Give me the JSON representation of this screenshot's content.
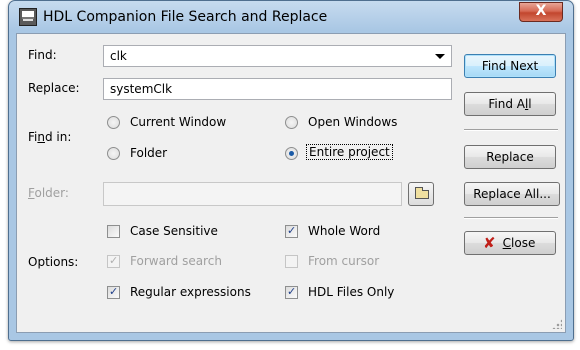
{
  "window": {
    "title": "HDL Companion File Search and Replace",
    "close_glyph": "X"
  },
  "find": {
    "label": "Find:",
    "value": "clk"
  },
  "replace": {
    "label": "Replace:",
    "value": "systemClk"
  },
  "find_in": {
    "label_pre": "Fi",
    "label_u": "n",
    "label_post": "d in:",
    "options": [
      {
        "label": "Current Window",
        "selected": false
      },
      {
        "label": "Open Windows",
        "selected": false
      },
      {
        "label": "Folder",
        "selected": false
      },
      {
        "label": "Entire project",
        "selected": true
      }
    ]
  },
  "folder": {
    "label_u": "F",
    "label_post": "older:",
    "value": ""
  },
  "options": {
    "label": "Options:",
    "case_sensitive": {
      "label": "Case Sensitive",
      "checked": false,
      "enabled": true
    },
    "whole_word": {
      "label": "Whole Word",
      "checked": true,
      "enabled": true
    },
    "forward_search": {
      "label": "Forward search",
      "checked": true,
      "enabled": false
    },
    "from_cursor": {
      "label": "From cursor",
      "checked": false,
      "enabled": false
    },
    "regular_expressions": {
      "label": "Regular expressions",
      "checked": true,
      "enabled": true
    },
    "hdl_files_only": {
      "label": "HDL Files Only",
      "checked": true,
      "enabled": true
    }
  },
  "buttons": {
    "find_next": "Find Next",
    "find_all_pre": "Find A",
    "find_all_u": "l",
    "find_all_post": "l",
    "replace": "Replace",
    "replace_all": "Replace All...",
    "close_u": "C",
    "close_post": "lose"
  },
  "icons": {
    "close_icon": "✘",
    "check_mark": "✓"
  }
}
